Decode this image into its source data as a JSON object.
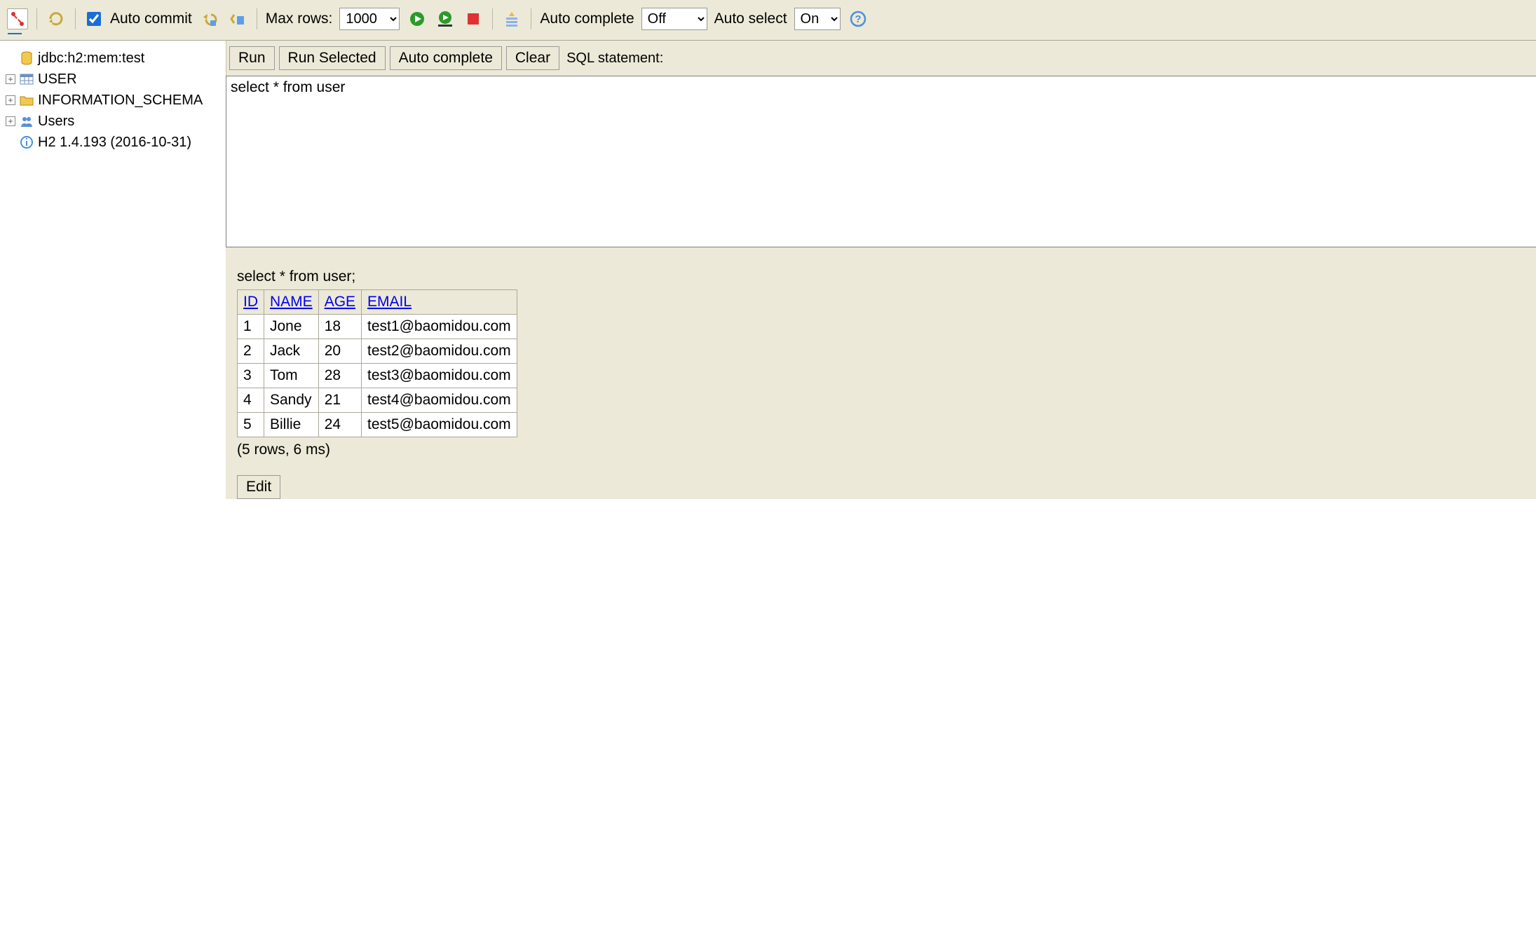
{
  "toolbar": {
    "auto_commit_label": "Auto commit",
    "auto_commit_checked": true,
    "max_rows_label": "Max rows:",
    "max_rows_value": "1000",
    "auto_complete_label": "Auto complete",
    "auto_complete_value": "Off",
    "auto_select_label": "Auto select",
    "auto_select_value": "On"
  },
  "sidebar": {
    "connection": "jdbc:h2:mem:test",
    "nodes": [
      {
        "label": "USER",
        "icon": "table"
      },
      {
        "label": "INFORMATION_SCHEMA",
        "icon": "folder"
      },
      {
        "label": "Users",
        "icon": "users"
      }
    ],
    "version": "H2 1.4.193 (2016-10-31)"
  },
  "buttons": {
    "run": "Run",
    "run_selected": "Run Selected",
    "auto_complete": "Auto complete",
    "clear": "Clear",
    "sql_label": "SQL statement:",
    "edit": "Edit"
  },
  "sql": "select * from user",
  "result": {
    "echo": "select * from user;",
    "columns": [
      "ID",
      "NAME",
      "AGE",
      "EMAIL"
    ],
    "rows": [
      [
        "1",
        "Jone",
        "18",
        "test1@baomidou.com"
      ],
      [
        "2",
        "Jack",
        "20",
        "test2@baomidou.com"
      ],
      [
        "3",
        "Tom",
        "28",
        "test3@baomidou.com"
      ],
      [
        "4",
        "Sandy",
        "21",
        "test4@baomidou.com"
      ],
      [
        "5",
        "Billie",
        "24",
        "test5@baomidou.com"
      ]
    ],
    "summary": "(5 rows, 6 ms)"
  }
}
